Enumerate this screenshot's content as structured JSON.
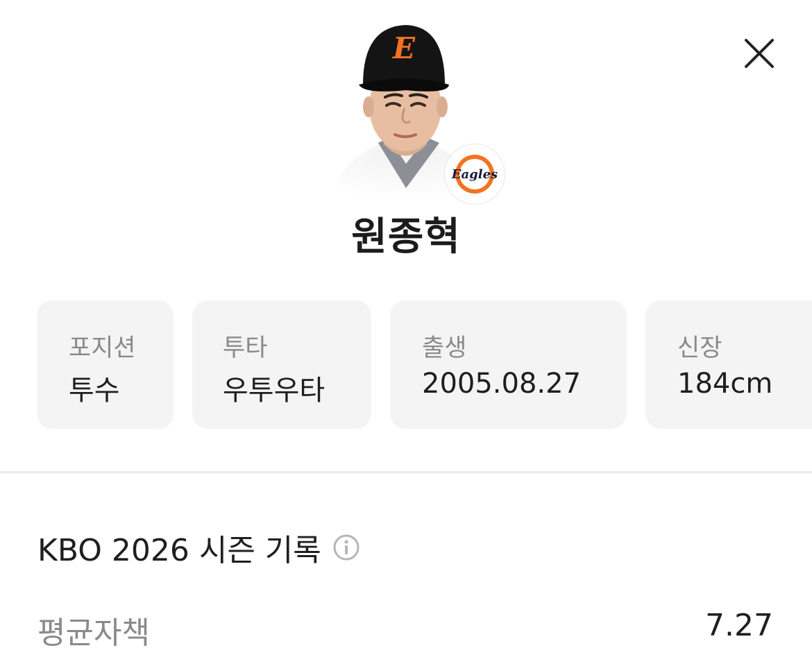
{
  "player": {
    "name": "원종혁",
    "team_logo_text": "Eagles",
    "cap_letter": "E"
  },
  "info_cards": [
    {
      "label": "포지션",
      "value": "투수"
    },
    {
      "label": "투타",
      "value": "우투우타"
    },
    {
      "label": "출생",
      "value": "2005.08.27"
    },
    {
      "label": "신장",
      "value": "184cm"
    }
  ],
  "season": {
    "title": "KBO 2026 시즌 기록",
    "stats": [
      {
        "label": "평균자책",
        "value": "7.27"
      }
    ]
  },
  "icons": {
    "close": "close-icon",
    "info": "info-circle-icon"
  },
  "colors": {
    "team_orange": "#f37321",
    "team_black": "#111111",
    "card_bg": "#f4f4f4",
    "label_gray": "#8a8a8a"
  }
}
